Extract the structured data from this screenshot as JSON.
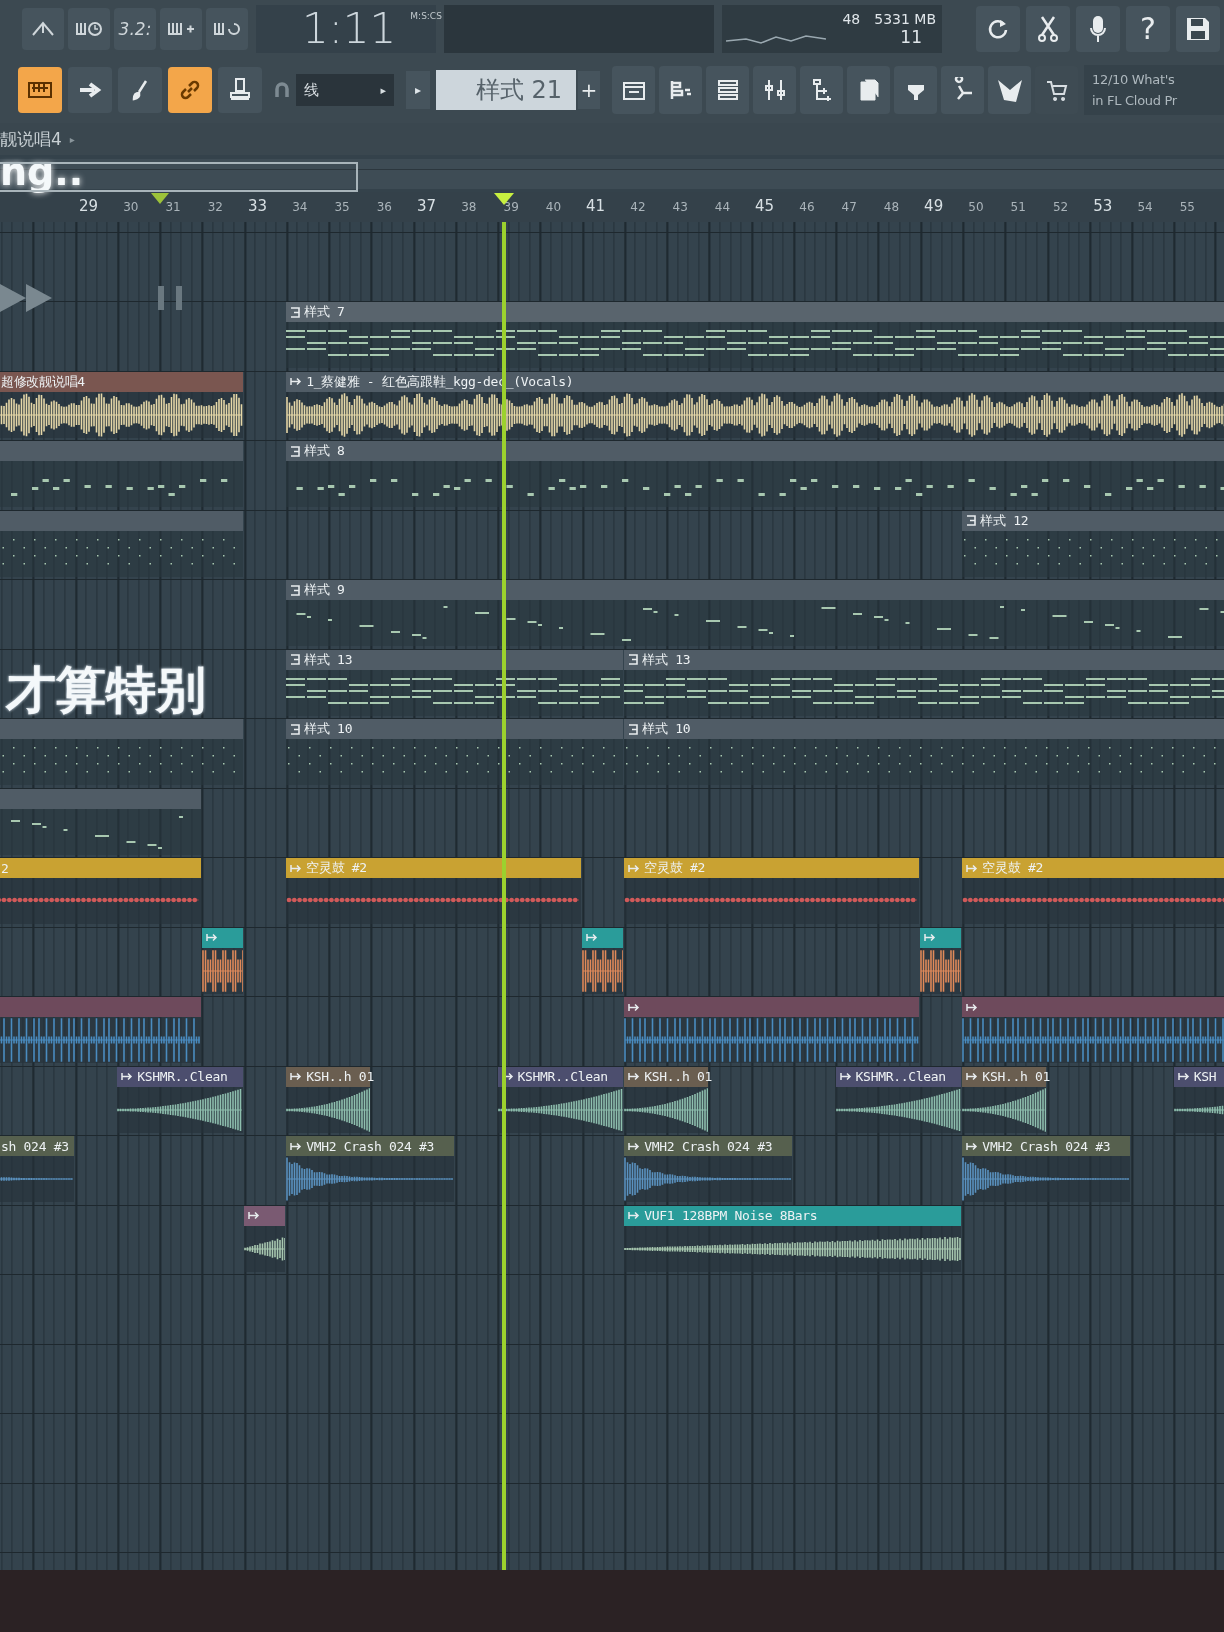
{
  "toolbar": {
    "snap_readout": "3.2:",
    "time": "1:11",
    "time_unit": "M:S:CS",
    "cpu": "48",
    "memory": "5331 MB",
    "polyphony": "11",
    "help": "?"
  },
  "tools": [
    {
      "on": true
    },
    {
      "on": false
    },
    {
      "on": false
    },
    {
      "on": true
    },
    {
      "on": false
    }
  ],
  "snap": {
    "value": "线",
    "arrow": "▸"
  },
  "pattern_selector": {
    "prev": "▸",
    "value": "样式 21",
    "add": "+"
  },
  "hint": [
    "12/10  What's",
    "in FL Cloud Pr"
  ],
  "breadcrumb": {
    "text": "靓说唱4",
    "arrow": "▸"
  },
  "overlay_texts": [
    "ng..",
    "才算特别"
  ],
  "ruler": [
    {
      "label": "29",
      "major": true
    },
    {
      "label": "30",
      "major": false
    },
    {
      "label": "31",
      "major": false
    },
    {
      "label": "32",
      "major": false
    },
    {
      "label": "33",
      "major": true
    },
    {
      "label": "34",
      "major": false
    },
    {
      "label": "35",
      "major": false
    },
    {
      "label": "36",
      "major": false
    },
    {
      "label": "37",
      "major": true
    },
    {
      "label": "38",
      "major": false
    },
    {
      "label": "39",
      "major": false
    },
    {
      "label": "40",
      "major": false
    },
    {
      "label": "41",
      "major": true
    },
    {
      "label": "42",
      "major": false
    },
    {
      "label": "43",
      "major": false
    },
    {
      "label": "44",
      "major": false
    },
    {
      "label": "45",
      "major": true
    },
    {
      "label": "46",
      "major": false
    },
    {
      "label": "47",
      "major": false
    },
    {
      "label": "48",
      "major": false
    },
    {
      "label": "49",
      "major": true
    },
    {
      "label": "50",
      "major": false
    },
    {
      "label": "51",
      "major": false
    },
    {
      "label": "52",
      "major": false
    },
    {
      "label": "53",
      "major": true
    },
    {
      "label": "54",
      "major": false
    },
    {
      "label": "55",
      "major": false
    }
  ],
  "tracks": [
    {
      "clips": [
        {
          "kind": "pattern",
          "label": "样式 7",
          "color": "#59646d"
        }
      ]
    },
    {
      "clips": [
        {
          "kind": "audio",
          "label": "超修改靓说唱4",
          "color": "#7a5650"
        },
        {
          "kind": "audio",
          "label": "1_蔡健雅 - 红色高跟鞋_kgg-dec_(Vocals)",
          "color": "#505c66"
        }
      ]
    },
    {
      "clips": [
        {
          "kind": "pattern",
          "color": "#505c66"
        },
        {
          "kind": "pattern",
          "label": "样式 8",
          "color": "#505c66"
        }
      ]
    },
    {
      "clips": [
        {
          "kind": "pattern",
          "color": "#505c66"
        },
        {
          "kind": "pattern",
          "label": "样式 12",
          "color": "#505c66"
        }
      ]
    },
    {
      "clips": [
        {
          "kind": "pattern",
          "label": "样式 9",
          "color": "#505c66"
        }
      ]
    },
    {
      "clips": [
        {
          "kind": "pattern",
          "label": "样式 13",
          "color": "#505c66"
        },
        {
          "kind": "pattern",
          "label": "样式 13",
          "color": "#505c66"
        }
      ]
    },
    {
      "clips": [
        {
          "kind": "pattern",
          "color": "#505c66"
        },
        {
          "kind": "pattern",
          "label": "样式 10",
          "color": "#505c66"
        },
        {
          "kind": "pattern",
          "label": "样式 10",
          "color": "#505c66"
        }
      ]
    },
    {
      "clips": [
        {
          "kind": "pattern",
          "color": "#505c66"
        }
      ]
    },
    {
      "clips": [
        {
          "kind": "audio",
          "label": "2",
          "color": "#c9a232"
        },
        {
          "kind": "audio",
          "label": "空灵鼓 #2",
          "color": "#c9a232"
        },
        {
          "kind": "audio",
          "label": "空灵鼓 #2",
          "color": "#c9a232"
        },
        {
          "kind": "audio",
          "label": "空灵鼓 #2",
          "color": "#c9a232"
        }
      ]
    },
    {
      "clips": [
        {
          "kind": "audio",
          "color": "#2a9c9a"
        },
        {
          "kind": "audio",
          "color": "#2a9c9a"
        },
        {
          "kind": "audio",
          "color": "#2a9c9a"
        }
      ]
    },
    {
      "clips": [
        {
          "kind": "audio",
          "color": "#6e4a5c"
        },
        {
          "kind": "audio",
          "color": "#6e4a5c"
        },
        {
          "kind": "audio",
          "color": "#6e4a5c"
        }
      ]
    },
    {
      "clips": [
        {
          "kind": "audio",
          "label": "KSHMR..Clean",
          "color": "#4c4e6e"
        },
        {
          "kind": "audio",
          "label": "KSH..h 01",
          "color": "#6a5e50"
        },
        {
          "kind": "audio",
          "label": "KSHMR..Clean",
          "color": "#4c4e6e"
        },
        {
          "kind": "audio",
          "label": "KSH..h 01",
          "color": "#6a5e50"
        },
        {
          "kind": "audio",
          "label": "KSHMR..Clean",
          "color": "#4c4e6e"
        },
        {
          "kind": "audio",
          "label": "KSH..h 01",
          "color": "#6a5e50"
        },
        {
          "kind": "audio",
          "label": "KSH",
          "color": "#4c4e6e"
        }
      ]
    },
    {
      "clips": [
        {
          "kind": "audio",
          "label": "sh 024 #3",
          "color": "#56604e"
        },
        {
          "kind": "audio",
          "label": "VMH2 Crash 024 #3",
          "color": "#56604e"
        },
        {
          "kind": "audio",
          "label": "VMH2 Crash 024 #3",
          "color": "#56604e"
        },
        {
          "kind": "audio",
          "label": "VMH2 Crash 024 #3",
          "color": "#56604e"
        }
      ]
    },
    {
      "clips": [
        {
          "kind": "audio",
          "color": "#7a5a72"
        },
        {
          "kind": "audio",
          "label": "VUF1 128BPM Noise 8Bars",
          "color": "#2a9c9a"
        }
      ]
    }
  ]
}
